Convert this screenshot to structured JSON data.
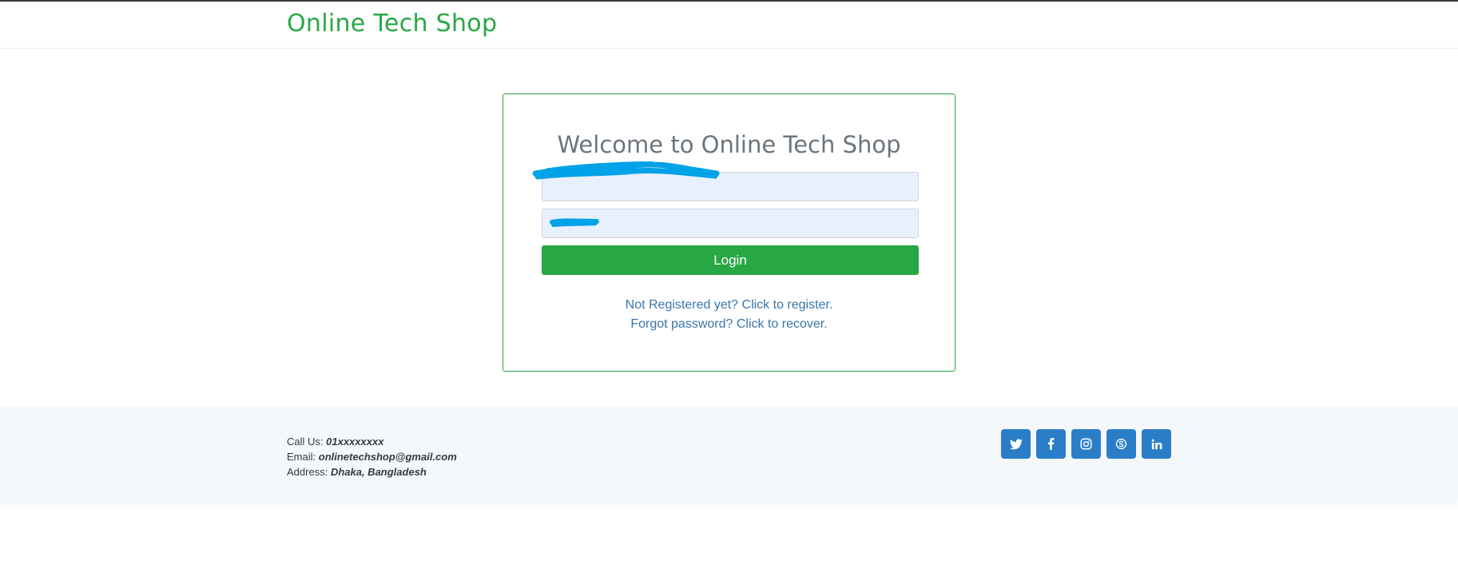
{
  "header": {
    "brand": "Online Tech Shop"
  },
  "login": {
    "title": "Welcome to Online Tech Shop",
    "email_value": "",
    "password_value": "",
    "button_label": "Login",
    "register_link": "Not Registered yet? Click to register.",
    "recover_link": "Forgot password? Click to recover."
  },
  "footer": {
    "call_label": "Call Us:",
    "call_value": "01xxxxxxxx",
    "email_label": "Email:",
    "email_value": "onlinetechshop@gmail.com",
    "address_label": "Address:",
    "address_value": "Dhaka, Bangladesh",
    "socials": [
      "twitter-icon",
      "facebook-icon",
      "instagram-icon",
      "skype-icon",
      "linkedin-icon"
    ]
  },
  "colors": {
    "brand": "#28a745",
    "link": "#3a75a8",
    "social": "#2a7ec8",
    "redaction": "#00a2e8"
  }
}
